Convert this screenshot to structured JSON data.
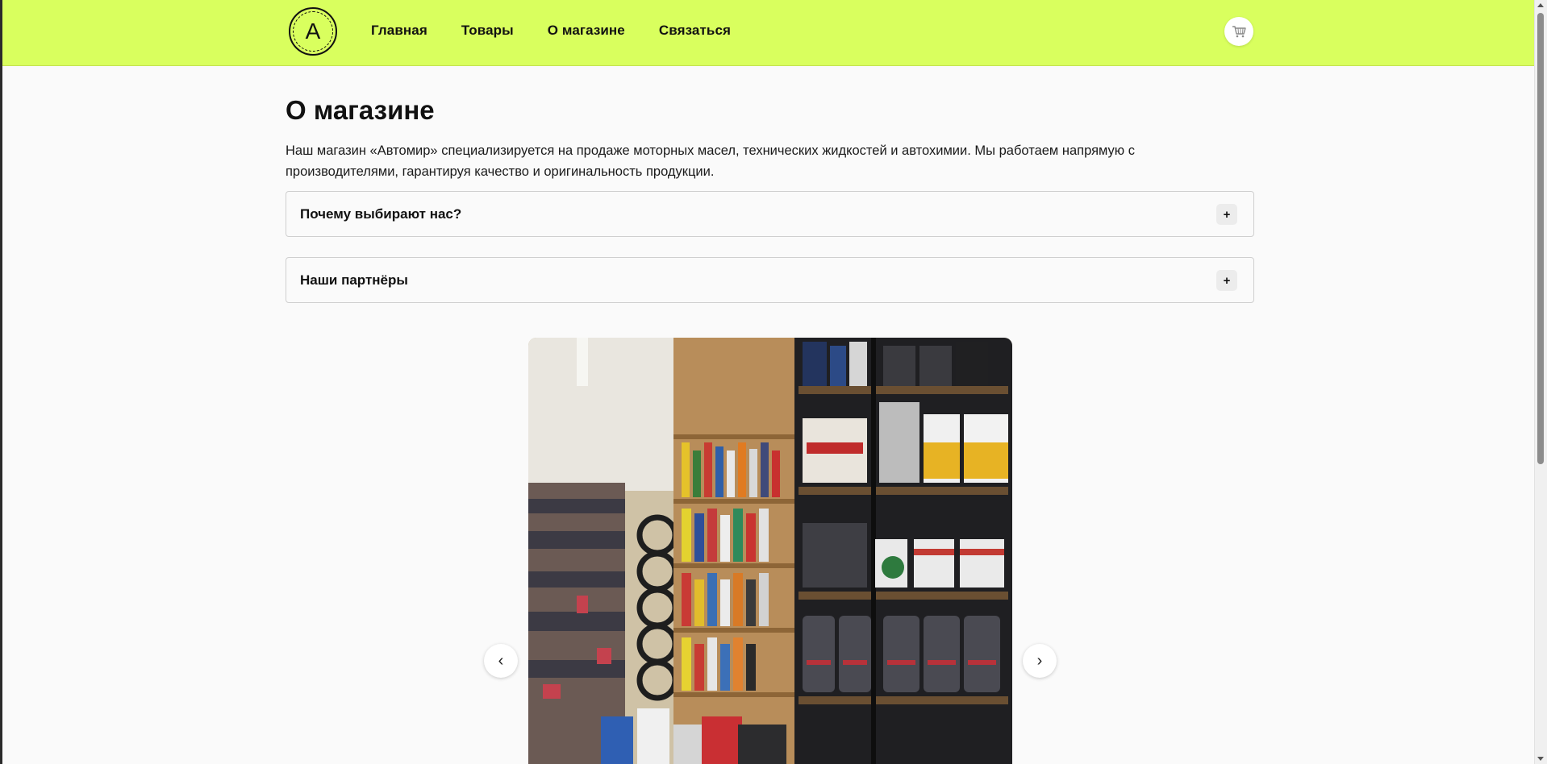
{
  "header": {
    "logo_letter": "A",
    "nav": [
      {
        "label": "Главная"
      },
      {
        "label": "Товары"
      },
      {
        "label": "О магазине"
      },
      {
        "label": "Связаться"
      }
    ],
    "cart_icon": "cart-icon"
  },
  "main": {
    "title": "О магазине",
    "intro": "Наш магазин «Автомир» специализируется на продаже моторных масел, технических жидкостей и автохимии. Мы работаем напрямую с производителями, гарантируя качество и оригинальность продукции.",
    "accordions": [
      {
        "title": "Почему выбирают нас?",
        "toggle": "+"
      },
      {
        "title": "Наши партнёры",
        "toggle": "+"
      }
    ],
    "carousel": {
      "prev": "‹",
      "next": "›"
    }
  },
  "colors": {
    "header_bg": "#d9ff5e",
    "page_bg": "#fafafa"
  }
}
